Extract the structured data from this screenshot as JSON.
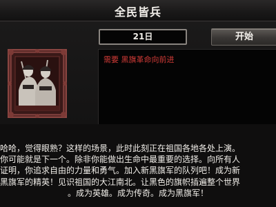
{
  "window": {
    "title": "全民皆兵"
  },
  "event": {
    "date_label": "21日",
    "start_button_label": "开始",
    "requirement_text": "需要 黑旗革命向前进"
  },
  "story": {
    "lines": [
      "哈哈，觉得眼熟？这样的场景，此时此刻正在祖国各地各处上演。",
      "你可能就是下一个。除非你能做出生命中最重要的选择。向所有人",
      "证明，你追求自由的力量和勇气。加入新黑旗军的队列吧！成为新",
      "黑旗军的精英！见识祖国的大江南北。让黑色的旗帜插遍整个世界",
      "。成为英雄。成为传奇。成为黑旗军！"
    ]
  },
  "colors": {
    "title_text": "#f4f1ec",
    "requirement_text": "#d23b37",
    "story_text": "#f2efea"
  },
  "icons": {
    "portrait": "two-soldiers-with-rifles-portrait"
  }
}
